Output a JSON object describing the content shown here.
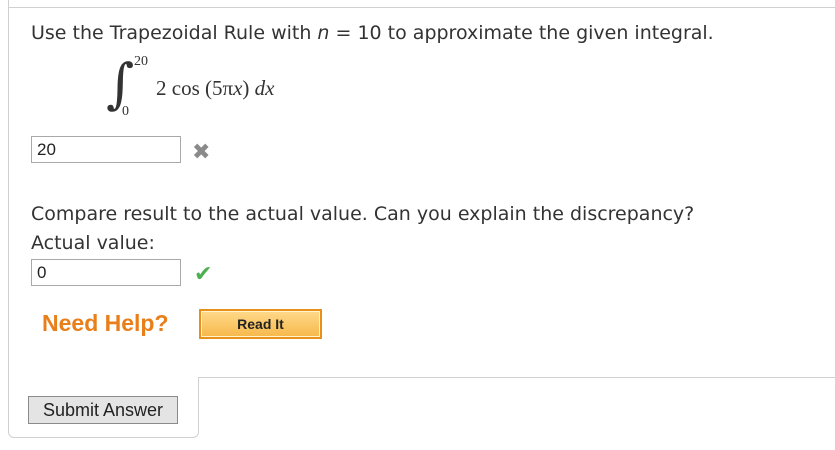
{
  "question": {
    "prefix": "Use the Trapezoidal Rule with ",
    "variable": "n",
    "suffix": " = 10 to approximate the given integral."
  },
  "integral": {
    "upper_limit": "20",
    "lower_limit": "0",
    "integrand_coefficient": "2 cos (5π",
    "integrand_var": "x",
    "integrand_close": ") ",
    "differential": "dx"
  },
  "answer1": {
    "value": "20",
    "status": "incorrect"
  },
  "compare_text": "Compare result to the actual value. Can you explain the discrepancy?",
  "actual_label": "Actual value:",
  "answer2": {
    "value": "0",
    "status": "correct"
  },
  "help": {
    "label": "Need Help?",
    "read_it_label": "Read It"
  },
  "submit_label": "Submit Answer",
  "colors": {
    "help_orange": "#e87f1a",
    "correct_green": "#4caf50",
    "incorrect_gray": "#8a8a8a"
  }
}
